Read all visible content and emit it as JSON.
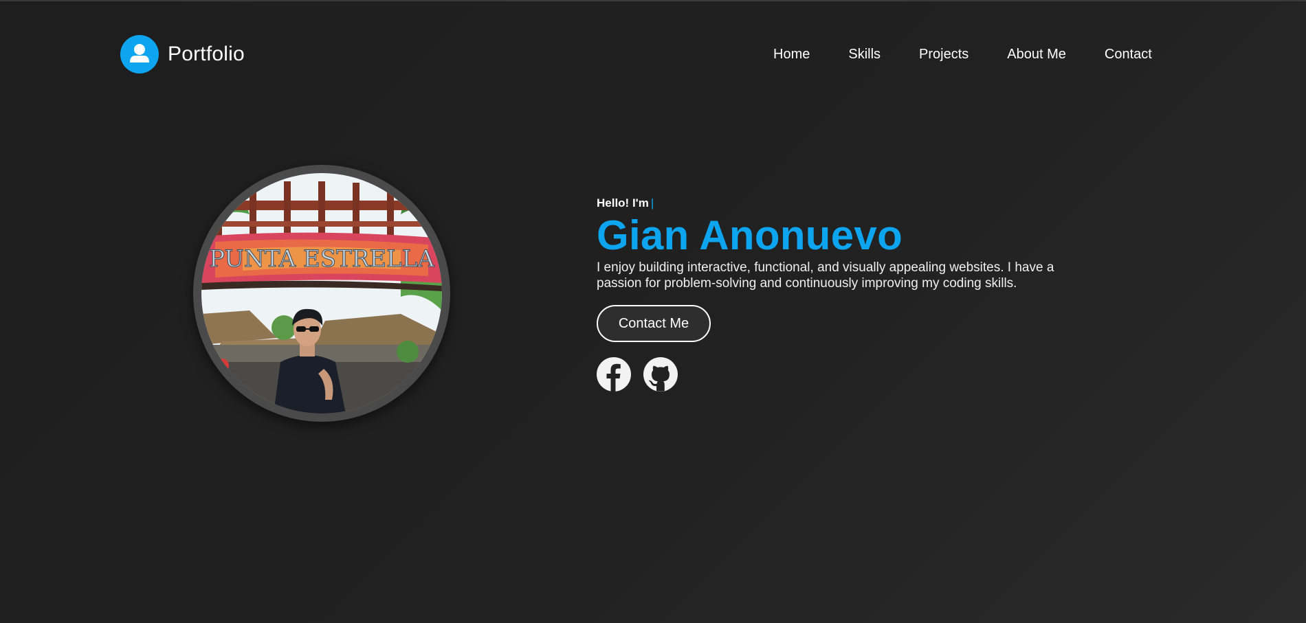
{
  "header": {
    "brand_name": "Portfolio",
    "brand_icon": "user-icon",
    "nav": [
      {
        "label": "Home"
      },
      {
        "label": "Skills"
      },
      {
        "label": "Projects"
      },
      {
        "label": "About Me"
      },
      {
        "label": "Contact"
      }
    ]
  },
  "hero": {
    "greeting": "Hello! I'm",
    "typing_cursor": "|",
    "name": "Gian Anonuevo",
    "bio": "I enjoy building interactive, functional, and visually appealing websites. I have a passion for problem-solving and continuously improving my coding skills.",
    "contact_button": "Contact Me",
    "photo_sign_text": "PUNTA ESTRELLA",
    "socials": [
      {
        "icon": "facebook-icon"
      },
      {
        "icon": "github-icon"
      }
    ]
  },
  "colors": {
    "accent": "#0ea5f0",
    "background": "#1e1e1e"
  }
}
